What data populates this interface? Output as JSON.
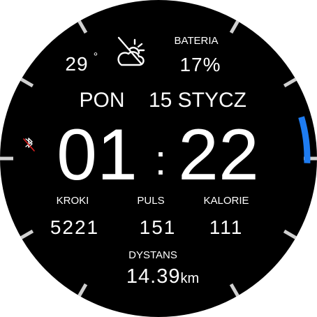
{
  "weather": {
    "temperature": "29",
    "degree_symbol": "°",
    "icon": "weather-unavailable-icon"
  },
  "battery": {
    "label": "BATERIA",
    "value": "17%",
    "level": 0.17
  },
  "date": {
    "weekday": "PON",
    "day_month": "15 STYCZ"
  },
  "time": {
    "hours": "01",
    "separator": ":",
    "minutes": "22"
  },
  "bluetooth": {
    "icon": "bluetooth-disconnected-icon"
  },
  "stats": {
    "steps_label": "KROKI",
    "steps_value": "5221",
    "pulse_label": "PULS",
    "pulse_value": "151",
    "calories_label": "KALORIE",
    "calories_value": "111"
  },
  "distance": {
    "label": "DYSTANS",
    "value": "14.39",
    "unit": "km"
  },
  "colors": {
    "background": "#000000",
    "text": "#ffffff",
    "accent": "#1e7cf2",
    "alert": "#e02020",
    "tick": "#d0d0d0"
  }
}
